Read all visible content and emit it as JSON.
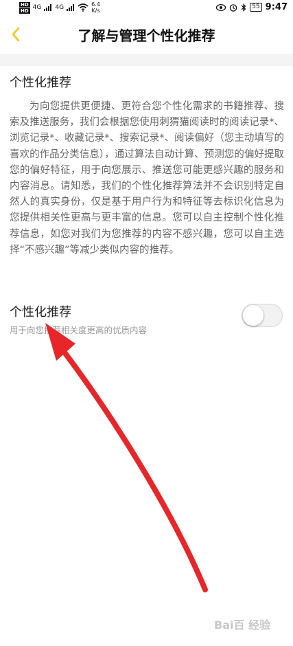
{
  "status_bar": {
    "hd_top": "HD",
    "hd_bottom": "HD",
    "signal_1": "4G",
    "signal_2": "4G",
    "speed_value": "6.4",
    "speed_unit": "K/s",
    "battery": "55",
    "time": "9:47"
  },
  "nav": {
    "title": "了解与管理个性化推荐"
  },
  "intro": {
    "title": "个性化推荐",
    "body": "为向您提供更便捷、更符合您个性化需求的书籍推荐、搜索及推送服务，我们会根据您使用刺猬猫阅读时的阅读记录*、浏览记录*、收藏记录*、搜索记录*、阅读偏好（您主动填写的喜欢的作品分类信息），通过算法自动计算、预测您的偏好提取您的偏好特征，用于向您展示、推送您可能更感兴趣的服务和内容消息。请知悉，我们的个性化推荐算法并不会识别特定自然人的真实身份，仅是基于用户行为和特征等去标识化信息为您提供相关性更高与更丰富的信息。您可以自主控制个性化推荐信息，如您对我们为您推荐的内容不感兴趣，您可以自主选择“不感兴趣”等减少类似内容的推荐。"
  },
  "setting": {
    "label": "个性化推荐",
    "description": "用于向您推荐相关度更高的优质内容",
    "enabled": false
  },
  "watermark": "Bai百 经验",
  "colors": {
    "accent": "#f5c518",
    "annotation_arrow": "#e8262a",
    "body_text": "#666666",
    "divider": "#f4f4f4"
  },
  "icons": {
    "back": "chevron-left-icon",
    "eye": "eye-icon",
    "alarm": "alarm-icon",
    "bluetooth": "bluetooth-icon",
    "wifi": "wifi-icon"
  }
}
